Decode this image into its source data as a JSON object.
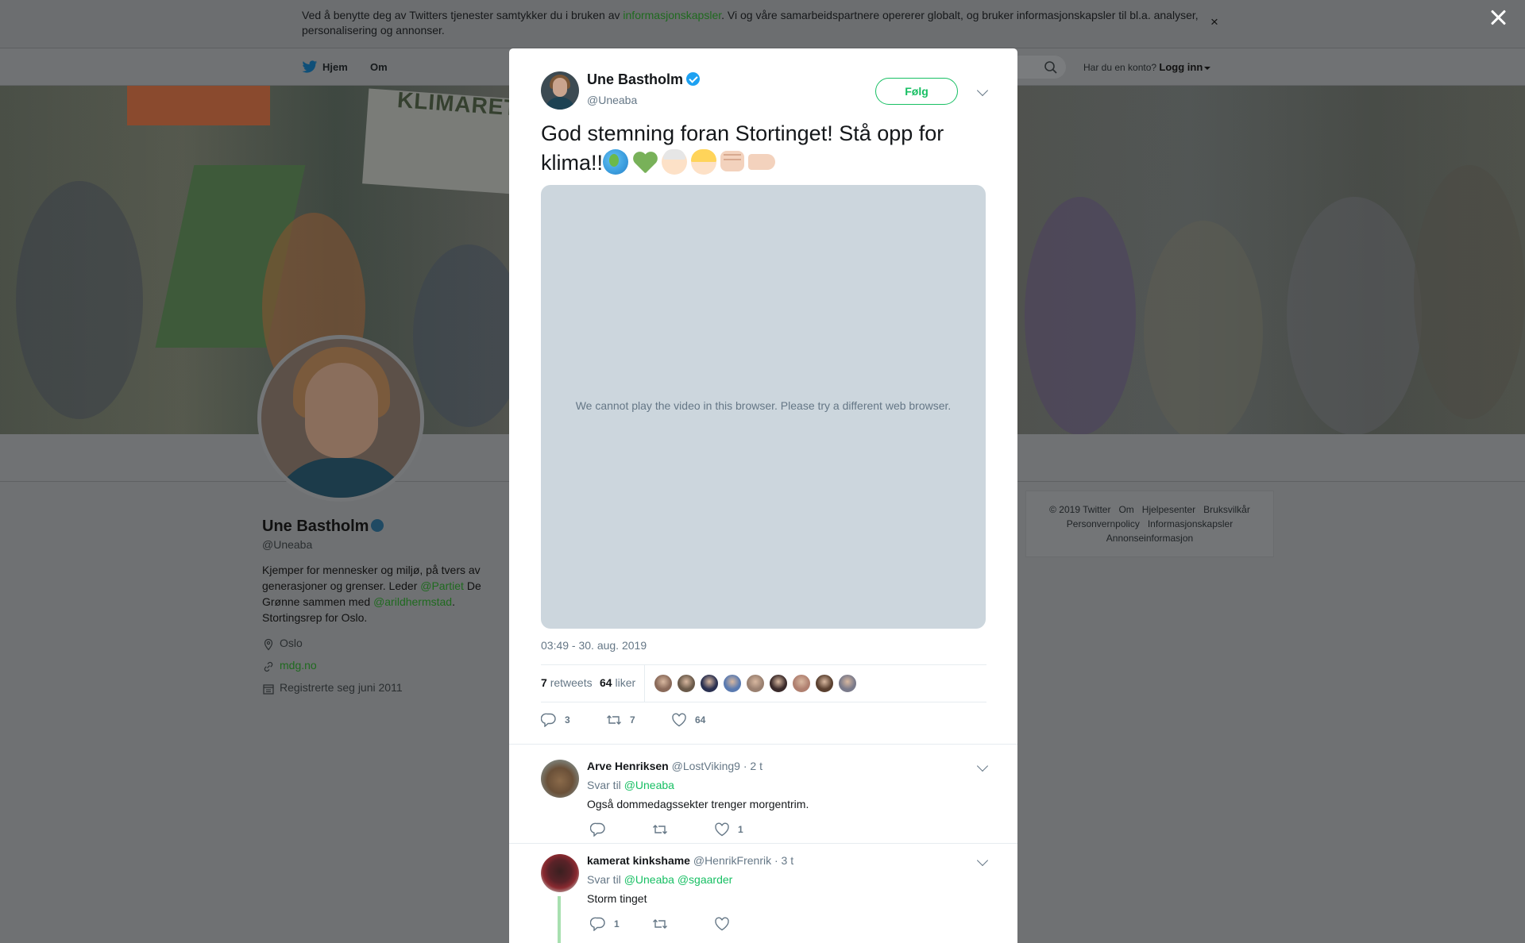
{
  "cookie": {
    "text_before": "Ved å benytte deg av Twitters tjenester samtykker du i bruken av ",
    "link": "informasjonskapsler",
    "text_after": ". Vi og våre samarbeidspartnere opererer globalt, og bruker informasjonskapsler til bl.a. analyser, personalisering og annonser.",
    "close": "×"
  },
  "nav": {
    "home": "Hjem",
    "about": "Om",
    "account_prompt": "Har du en konto?",
    "login": "Logg inn"
  },
  "profile": {
    "name": "Une Bastholm",
    "handle": "@Uneaba",
    "bio_1": "Kjemper for mennesker og miljø, på tvers av generasjoner og grenser. Leder ",
    "bio_link_1": "@Partiet",
    "bio_2": " De Grønne sammen med ",
    "bio_link_2": "@arildhermstad",
    "bio_3": ". Stortingsrep for Oslo.",
    "location": "Oslo",
    "website": "mdg.no",
    "joined": "Registrerte seg juni 2011",
    "banner_sign": "KLIMARETT"
  },
  "footer": {
    "copyright": "© 2019 Twitter",
    "about": "Om",
    "help": "Hjelpesenter",
    "terms": "Bruksvilkår",
    "privacy": "Personvernpolicy",
    "cookies": "Informasjonskapsler",
    "ads": "Annonseinformasjon"
  },
  "tweet": {
    "author_name": "Une Bastholm",
    "author_handle": "@Uneaba",
    "follow_label": "Følg",
    "text": "God stemning foran Stortinget! Stå opp for klima!!",
    "emojis": [
      "globe-emoji",
      "green-heart-emoji",
      "boy-emoji",
      "girl-emoji",
      "fist-emoji",
      "hand-emoji"
    ],
    "video_message": "We cannot play the video in this browser. Please try a different web browser.",
    "timestamp": "03:49 - 30. aug. 2019",
    "retweets_count": "7",
    "retweets_label": "retweets",
    "likes_count": "64",
    "likes_label": "liker",
    "likers_colors": [
      "#8a6a5a",
      "#6a5a4a",
      "#2a3050",
      "#5a7ab0",
      "#9a8070",
      "#3a2a2a",
      "#b08070",
      "#5a4030",
      "#7a7a8a"
    ],
    "action_replies": "3",
    "action_retweets": "7",
    "action_likes": "64"
  },
  "replies": [
    {
      "name": "Arve Henriksen",
      "handle": "@LostViking9",
      "time": "· 2 t",
      "reply_to_label": "Svar til ",
      "reply_to": "@Uneaba",
      "reply_to_2": "",
      "text": "Også dommedagssekter trenger morgentrim.",
      "replies": "",
      "retweets": "",
      "likes": "1"
    },
    {
      "name": "kamerat kinkshame",
      "handle": "@HenrikFrenrik",
      "time": "· 3 t",
      "reply_to_label": "Svar til ",
      "reply_to": "@Uneaba",
      "reply_to_2": "@sgaarder",
      "text": "Storm tinget",
      "replies": "1",
      "retweets": "",
      "likes": ""
    }
  ],
  "colors": {
    "accent_green": "#17bf63",
    "verified_blue": "#1da1f2",
    "muted_text": "#657786",
    "video_placeholder": "#ccd6dd"
  }
}
